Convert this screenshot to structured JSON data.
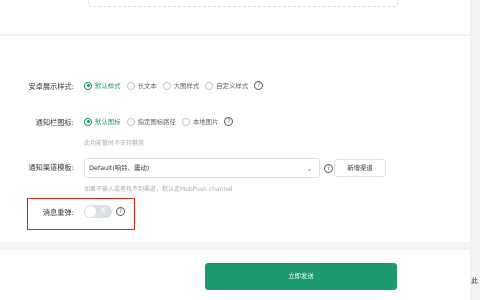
{
  "android_style": {
    "label": "安卓展示样式:",
    "options": [
      "默认样式",
      "长文本",
      "大图样式",
      "自定义样式"
    ],
    "selected": "默认样式",
    "help": "?"
  },
  "notif_icon": {
    "label": "通知栏图标:",
    "options": [
      "默认图标",
      "指定图标路径",
      "本地图片"
    ],
    "selected": "默认图标",
    "help": "?",
    "hint": "此功能暂时不支持魅族"
  },
  "channel_template": {
    "label": "通知渠道模板:",
    "value": "Default(响铃、震动)",
    "help": "?",
    "add_button": "新增渠道",
    "hint": "如果不输入或者找不到渠道，默认走MobPush channel"
  },
  "message_rebound": {
    "label": "消息重弹:",
    "switch_text": "关",
    "enabled": false,
    "help": "?"
  },
  "submit_button": "立即发送",
  "edge_text": "此",
  "colors": {
    "accent": "#1a9a6e",
    "highlight_border": "#e02020"
  }
}
